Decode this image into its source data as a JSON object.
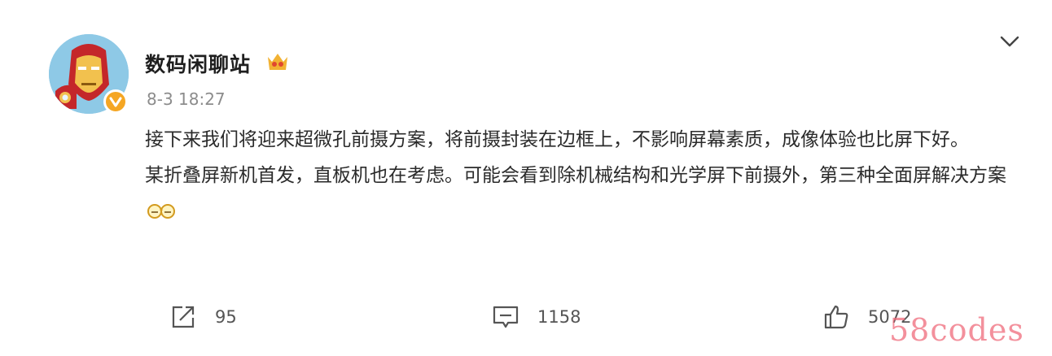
{
  "post": {
    "author": {
      "name": "数码闲聊站"
    },
    "timestamp": "8-3 18:27",
    "paragraphs": [
      "接下来我们将迎来超微孔前摄方案，将前摄封装在边框上，不影响屏幕素质，成像体验也比屏下好。",
      "某折叠屏新机首发，直板机也在考虑。可能会看到除机械结构和光学屏下前摄外，第三种全面屏解决方案"
    ],
    "actions": {
      "share_count": "95",
      "comment_count": "1158",
      "like_count": "5072"
    }
  },
  "watermark": "58codes",
  "icons": {
    "avatar": "iron-man-avatar",
    "verified": "verified-badge-icon",
    "crown": "crown-badge-icon",
    "menu": "chevron-down-icon",
    "share": "share-icon",
    "comment": "comment-icon",
    "like": "thumbs-up-icon",
    "emoji": "glasses-emoji-icon"
  },
  "colors": {
    "verified": "#f5a623",
    "crown": "#f2b233",
    "watermark": "#ef6b7b",
    "text": "#2b2b2b",
    "muted": "#8c8c8c"
  }
}
